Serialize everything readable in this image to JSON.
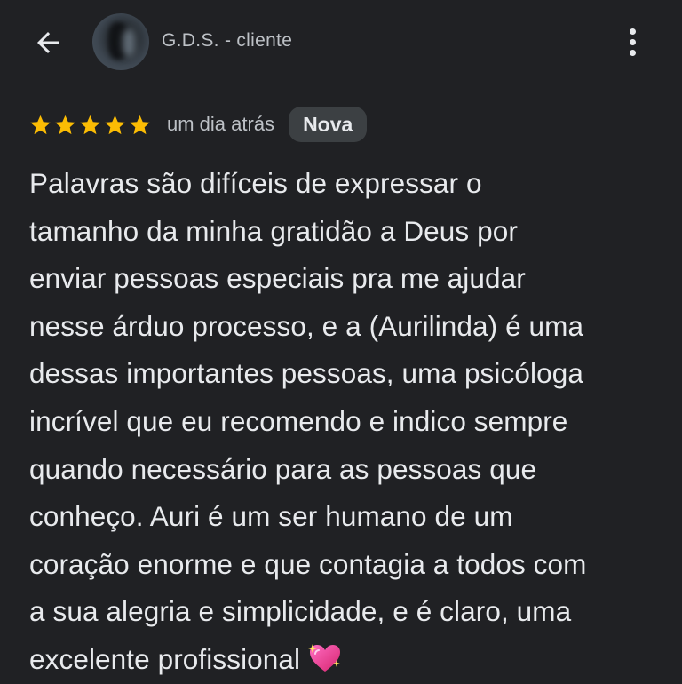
{
  "header": {
    "back_icon": "arrow-left-icon",
    "author": "G.D.S. - cliente",
    "more_icon": "more-vert-icon"
  },
  "review": {
    "rating": 5,
    "rating_max": 5,
    "star_color": "#fbbc04",
    "time": "um dia atrás",
    "badge": "Nova",
    "lines": [
      "Palavras são difíceis de expressar o",
      "tamanho da minha gratidão a Deus por",
      "enviar pessoas especiais pra me ajudar",
      "nesse árduo processo, e a (Aurilinda) é uma",
      "dessas importantes pessoas, uma psicóloga",
      "incrível que eu recomendo e indico sempre",
      "quando necessário para as pessoas que",
      "conheço. Auri é um ser humano de um",
      "coração enorme e que contagia a todos com",
      "a sua alegria e simplicidade, e é claro, uma",
      "excelente profissional"
    ],
    "emoji_icon": "sparkling-heart-icon"
  },
  "colors": {
    "background": "#202124",
    "text": "#e8eaed",
    "secondary_text": "#bdc1c6",
    "badge_bg": "#3c4043"
  }
}
